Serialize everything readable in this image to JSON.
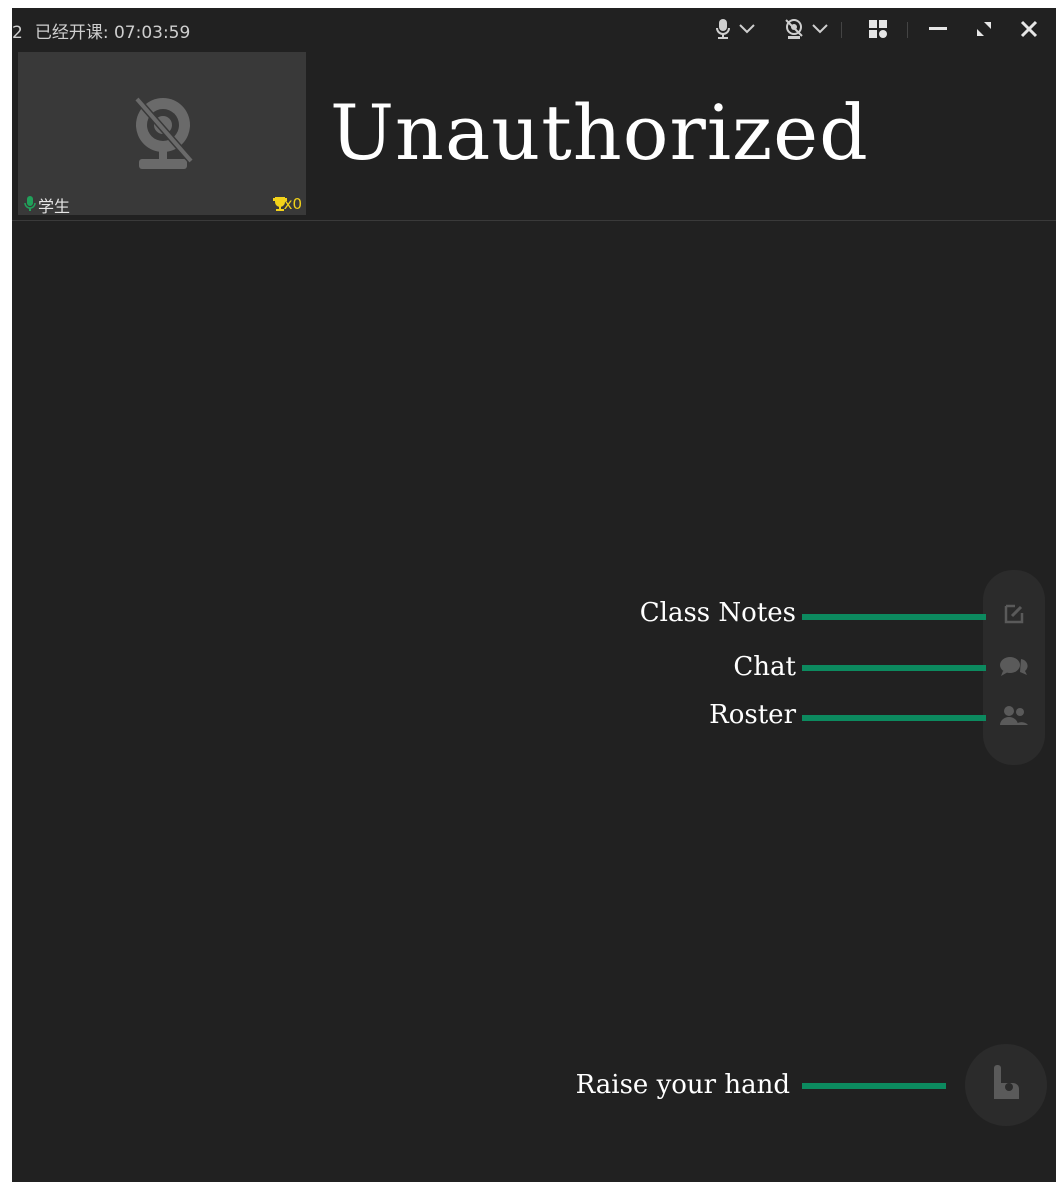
{
  "session": {
    "prefix": "2",
    "status_label": "已经开课: 07:03:59"
  },
  "toolbar": {
    "icons": [
      "mic-icon",
      "chevron-down-icon",
      "camera-off-icon",
      "chevron-down-icon",
      "layout-icon",
      "minimize-icon",
      "restore-icon",
      "close-icon"
    ]
  },
  "video_tile": {
    "name": "学生",
    "trophy_count": "x0"
  },
  "overlay": {
    "title": "Unauthorized",
    "annotations": {
      "class_notes": "Class Notes",
      "chat": "Chat",
      "roster": "Roster",
      "raise_hand": "Raise your hand"
    }
  },
  "colors": {
    "background": "#212121",
    "tile": "#393939",
    "accent_green": "#0c8a5f",
    "mic_green": "#21a05a",
    "trophy_yellow": "#f2d21a"
  }
}
